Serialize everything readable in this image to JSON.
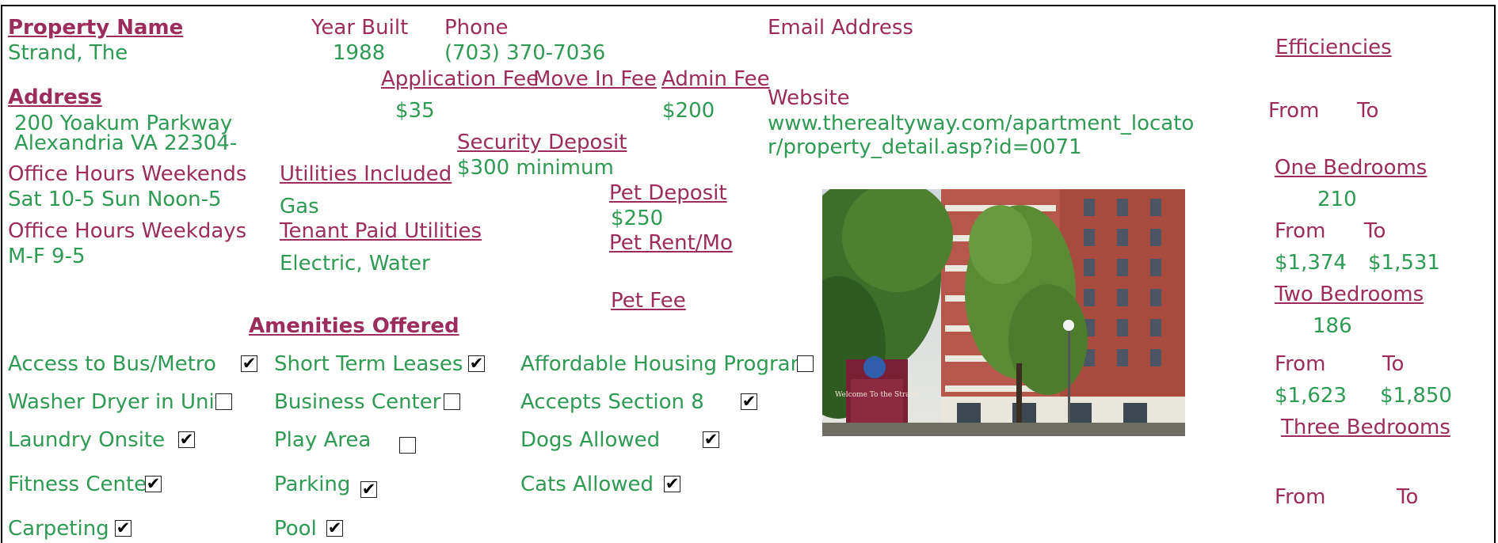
{
  "property": {
    "name_label": "Property Name",
    "name": "Strand, The",
    "address_label": "Address",
    "address_line1": "200 Yoakum Parkway",
    "address_line2": "Alexandria VA 22304-",
    "weekend_label": "Office Hours Weekends",
    "weekend_hours": "Sat 10-5 Sun Noon-5",
    "weekday_label": "Office Hours Weekdays",
    "weekday_hours": "M-F 9-5"
  },
  "info": {
    "year_label": "Year Built",
    "year": "1988",
    "phone_label": "Phone",
    "phone": "(703) 370-7036",
    "email_label": "Email Address",
    "website_label": "Website",
    "website": "www.therealtyway.com/apartment_locator/property_detail.asp?id=0071"
  },
  "fees": {
    "application_label": "Application Fee",
    "application": "$35",
    "move_in_label": "Move In Fee",
    "admin_label": "Admin Fee",
    "admin": "$200",
    "security_label": "Security Deposit",
    "security": "$300 minimum",
    "pet_deposit_label": "Pet Deposit",
    "pet_deposit": "$250",
    "pet_rent_label": "Pet Rent/Mo",
    "pet_fee_label": "Pet Fee"
  },
  "utilities": {
    "included_label": "Utilities Included",
    "included": "Gas",
    "tenant_label": "Tenant Paid Utilities",
    "tenant": "Electric, Water"
  },
  "amenities": {
    "title": "Amenities Offered",
    "items": [
      {
        "label": "Access to Bus/Metro",
        "checked": true
      },
      {
        "label": "Washer Dryer in Unit",
        "checked": false
      },
      {
        "label": "Laundry Onsite",
        "checked": true
      },
      {
        "label": "Fitness Center",
        "checked": true
      },
      {
        "label": "Carpeting",
        "checked": true
      },
      {
        "label": "Short Term Leases",
        "checked": true
      },
      {
        "label": "Business Center",
        "checked": false
      },
      {
        "label": "Play Area",
        "checked": false
      },
      {
        "label": "Parking",
        "checked": true
      },
      {
        "label": "Pool",
        "checked": true
      },
      {
        "label": "Affordable Housing Program",
        "checked": false
      },
      {
        "label": "Accepts Section 8",
        "checked": true
      },
      {
        "label": "Dogs Allowed",
        "checked": true
      },
      {
        "label": "Cats Allowed",
        "checked": true
      }
    ]
  },
  "units": {
    "efficiencies_label": "Efficiencies ",
    "eff_from_label": "From",
    "eff_to_label": "To",
    "one_label": "One Bedrooms",
    "one_count": "210",
    "one_from_label": "From",
    "one_to_label": "To",
    "one_from": "$1,374",
    "one_to": "$1,531",
    "two_label": "Two Bedrooms",
    "two_count": "186",
    "two_from_label": "From",
    "two_to_label": "To",
    "two_from": "$1,623",
    "two_to": "$1,850",
    "three_label": "Three Bedrooms",
    "three_from_label": "From",
    "three_to_label": "To"
  },
  "photo": {
    "sign_text": "Welcome To the Strand"
  }
}
